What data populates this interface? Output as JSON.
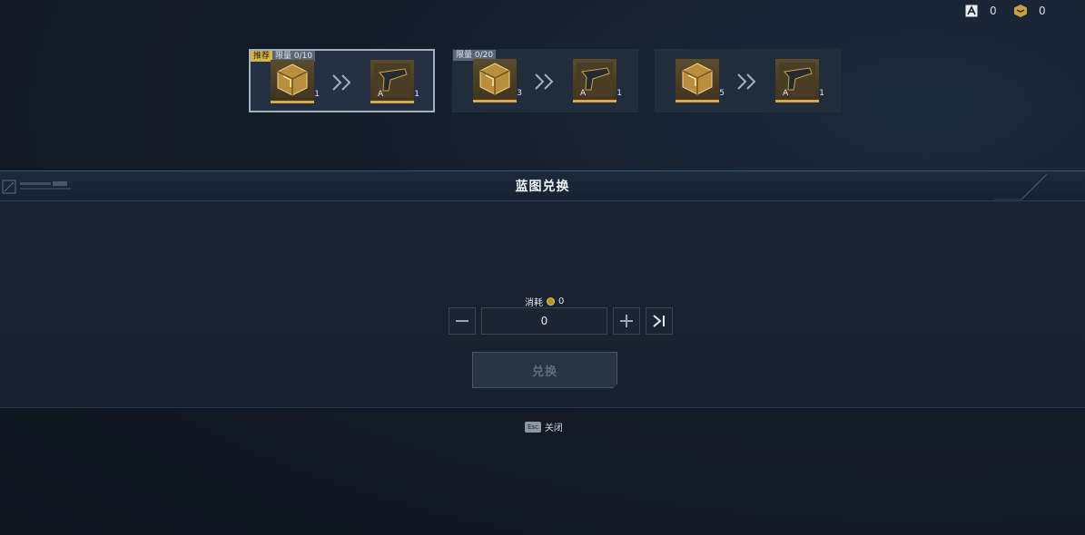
{
  "currencies": [
    {
      "icon": "blueprint-currency-icon",
      "value": "0"
    },
    {
      "icon": "gold-cube-currency-icon",
      "value": "0"
    }
  ],
  "panel": {
    "title": "蓝图兑换"
  },
  "cards": [
    {
      "tag_recommend": "推荐",
      "limit": "限量 0/10",
      "input_count": "1",
      "output_count": "1",
      "selected": true
    },
    {
      "tag_recommend": "",
      "limit": "限量 0/20",
      "input_count": "3",
      "output_count": "1",
      "selected": false
    },
    {
      "tag_recommend": "",
      "limit": "",
      "input_count": "5",
      "output_count": "1",
      "selected": false
    }
  ],
  "cost": {
    "label": "消耗",
    "value": "0"
  },
  "quantity": {
    "value": "0"
  },
  "exchange_button": {
    "label": "兑换"
  },
  "close": {
    "key": "Esc",
    "label": "关闭"
  },
  "colors": {
    "accent_gold": "#d6a84b",
    "recommend_tag": "#d5b349",
    "panel_border": "#3b5677"
  }
}
